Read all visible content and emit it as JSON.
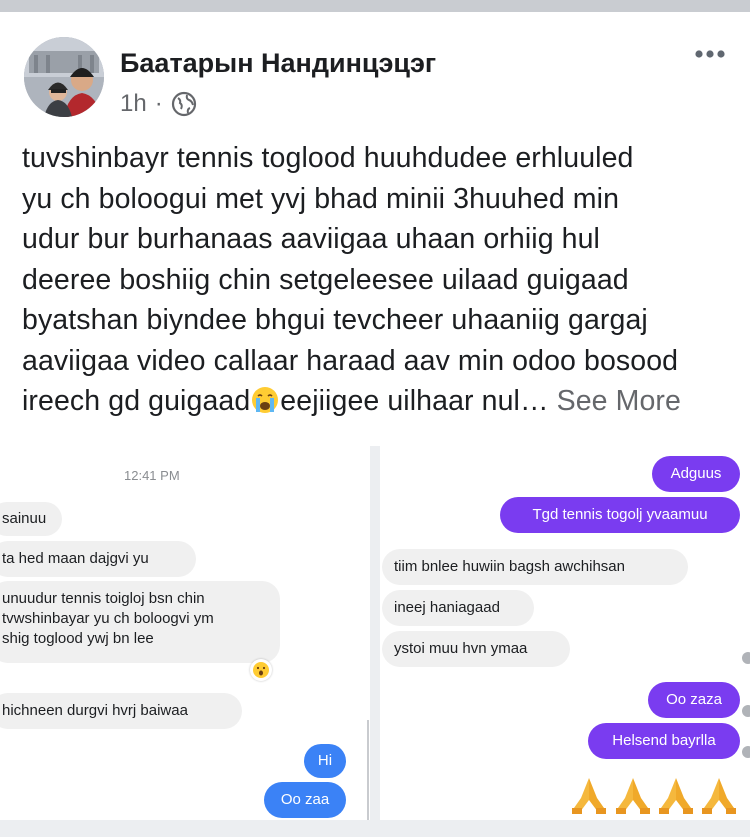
{
  "post": {
    "author": "Баатарын Нандинцэцэг",
    "time": "1h",
    "separator": "·",
    "privacy_icon": "globe-icon",
    "more_icon": "more-dots-icon",
    "text_lines": [
      "tuvshinbayr tennis toglood huuhdudee erhluuled",
      "yu ch boloogui met yvj bhad minii 3huuhed min",
      "udur bur burhanaas aaviigaa uhaan orhiig hul",
      "deeree boshiig chin setgeleesee uilaad guigaad",
      "byatshan biyndee bhgui tevcheer uhaaniig gargaj",
      "aaviigaa video callaar haraad aav min odoo bosood"
    ],
    "last_line_before_emoji": "ireech gd guigaad",
    "emoji": "crying-face-emoji",
    "last_line_after_emoji": "eejiigee uilhaar nul…",
    "see_more": "See More"
  },
  "chat_left": {
    "timestamp": "12:41 PM",
    "messages": [
      {
        "text": "sainuu",
        "dir": "in"
      },
      {
        "text": "ta hed maan dajgvi yu",
        "dir": "in"
      },
      {
        "lines": [
          "unuudur tennis toigloj bsn chin",
          "tvwshinbayar yu ch boloogvi ym",
          "shig toglood ywj bn lee"
        ],
        "dir": "in"
      },
      {
        "text": "hichneen durgvi hvrj baiwaa",
        "dir": "in"
      },
      {
        "text": "Hi",
        "dir": "out"
      },
      {
        "text": "Oo zaa",
        "dir": "out"
      }
    ],
    "reaction_icon": "surprised-face-reaction-icon"
  },
  "chat_right": {
    "messages": [
      {
        "text": "Adguus",
        "dir": "out"
      },
      {
        "text": "Tgd tennis togolj yvaamuu",
        "dir": "out"
      },
      {
        "text": "tiim bnlee huwiin bagsh awchihsan",
        "dir": "in"
      },
      {
        "text": "ineej haniagaad",
        "dir": "in"
      },
      {
        "text": "ystoi muu hvn ymaa",
        "dir": "in"
      },
      {
        "text": "Oo zaza",
        "dir": "out"
      },
      {
        "text": "Helsend bayrlla",
        "dir": "out"
      }
    ],
    "emoji_row": "folded-hands-emoji"
  },
  "colors": {
    "accent_blue": "#3b82f6",
    "accent_purple": "#7a3cf0",
    "incoming_bubble": "#f0f0f0",
    "secondary_text": "#65676b"
  }
}
